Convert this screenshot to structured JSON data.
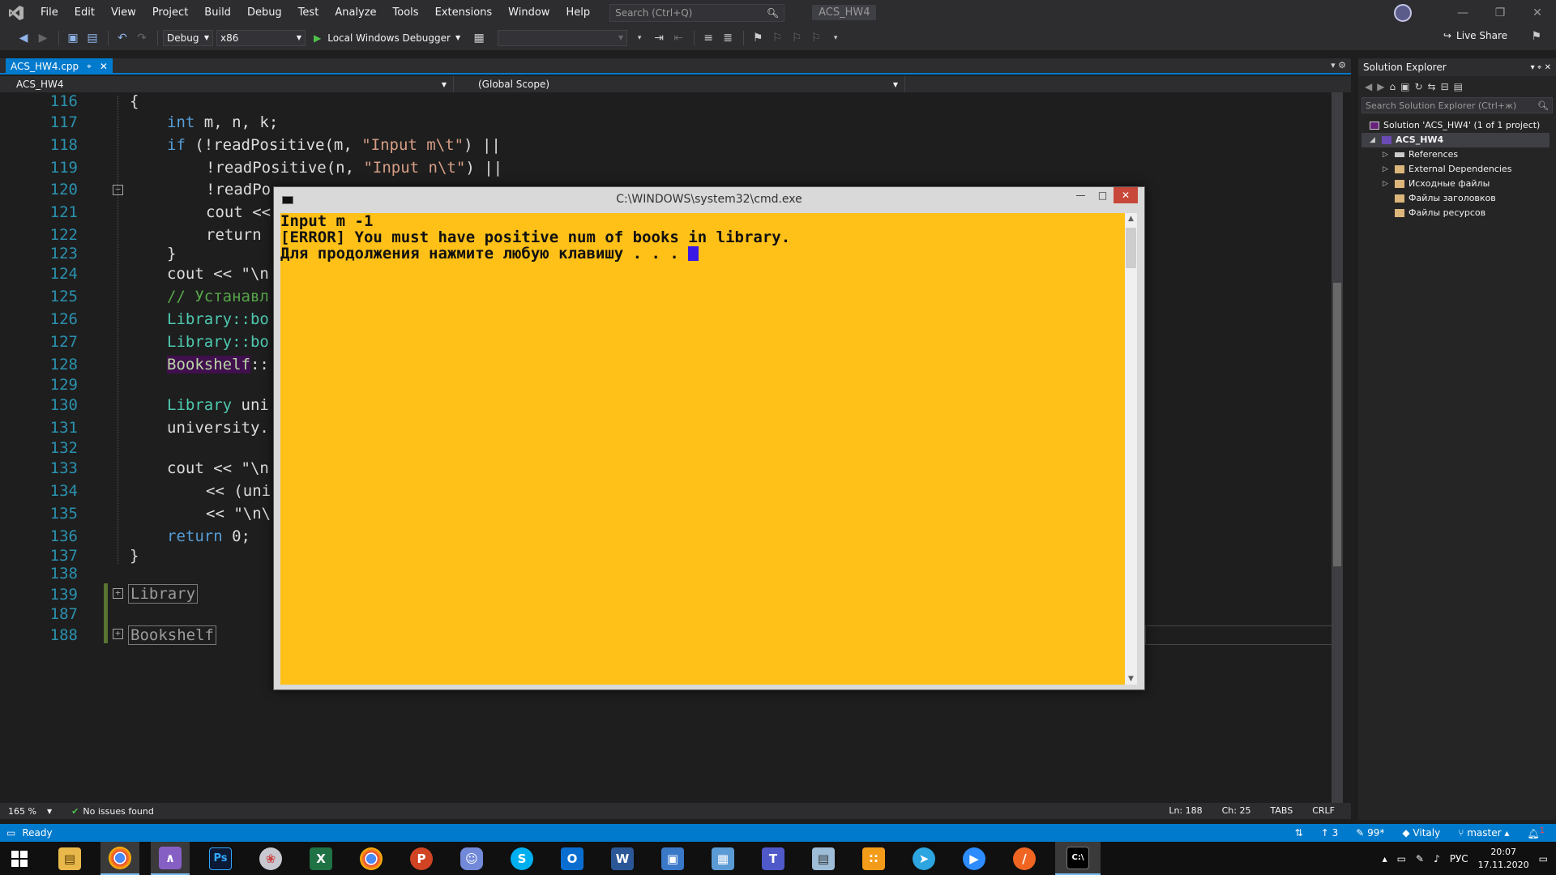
{
  "menu": {
    "items": [
      "File",
      "Edit",
      "View",
      "Project",
      "Build",
      "Debug",
      "Test",
      "Analyze",
      "Tools",
      "Extensions",
      "Window",
      "Help"
    ],
    "search_placeholder": "Search (Ctrl+Q)",
    "app_title": "ACS_HW4"
  },
  "toolbar": {
    "configuration": "Debug",
    "platform": "x86",
    "run_label": "Local Windows Debugger",
    "live_share": "Live Share"
  },
  "tab": {
    "filename": "ACS_HW4.cpp"
  },
  "navbar": {
    "project": "ACS_HW4",
    "scope": "(Global Scope)"
  },
  "editor": {
    "line_numbers": [
      "116",
      "117",
      "118",
      "119",
      "120",
      "121",
      "122",
      "123",
      "124",
      "125",
      "126",
      "127",
      "128",
      "129",
      "130",
      "131",
      "132",
      "133",
      "134",
      "135",
      "136",
      "137",
      "138",
      "139",
      "187",
      "188"
    ],
    "lines": {
      "l116": "{",
      "l117_kw": "int",
      "l117_rest": " m, n, k;",
      "l118_kw": "if",
      "l118_a": " (!readPositive(m, ",
      "l118_str": "\"Input m\\t\"",
      "l118_b": ") ||",
      "l119_a": "!readPositive(n, ",
      "l119_str": "\"Input n\\t\"",
      "l119_b": ") ||",
      "l120": "!readPo",
      "l121": "cout <<",
      "l122": "return",
      "l123": "}",
      "l124": "cout << \"\\n",
      "l125": "// Устанавл",
      "l126": "Library::bo",
      "l127": "Library::bo",
      "l128_hl": "Bookshelf",
      "l128_rest": "::",
      "l130_ty": "Library",
      "l130_rest": " uni",
      "l131": "university.",
      "l133": "cout << \"\\n",
      "l134": "<< (uni",
      "l135": "<< \"\\n\\",
      "l136_kw": "return",
      "l136_rest": " 0;",
      "l137": "}",
      "l139": "Library",
      "l188": "Bookshelf"
    }
  },
  "editor_status": {
    "zoom": "165 %",
    "issues": "No issues found",
    "line": "Ln: 188",
    "col": "Ch: 25",
    "indent": "TABS",
    "eol": "CRLF"
  },
  "solution_explorer": {
    "title": "Solution Explorer",
    "search_placeholder": "Search Solution Explorer (Ctrl+ж)",
    "solution": "Solution 'ACS_HW4' (1 of 1 project)",
    "project": "ACS_HW4",
    "items": [
      "References",
      "External Dependencies",
      "Исходные файлы",
      "Файлы заголовков",
      "Файлы ресурсов"
    ]
  },
  "statusbar": {
    "ready": "Ready",
    "pending": "3",
    "edits": "99*",
    "user": "Vitaly",
    "branch": "master",
    "notifications": "1"
  },
  "cmd": {
    "title": "C:\\WINDOWS\\system32\\cmd.exe",
    "line1": "Input m -1",
    "line2": "[ERROR] You must have positive num of books in library.",
    "line3": "Для продолжения нажмите любую клавишу . . . "
  },
  "taskbar": {
    "language": "РУС",
    "time": "20:07",
    "date": "17.11.2020",
    "apps": [
      "start-icon",
      "file-explorer-icon",
      "chrome-icon",
      "visual-studio-icon",
      "photoshop-icon",
      "paint-icon",
      "excel-icon",
      "chrome-alt-icon",
      "powerpoint-icon",
      "discord-icon",
      "skype-icon",
      "outlook-icon",
      "word-icon",
      "computer-icon",
      "remote-desktop-icon",
      "teams-icon",
      "calculator-icon",
      "network-icon",
      "telegram-icon",
      "zoom-icon",
      "terminal-app-icon",
      "cmd-icon"
    ]
  },
  "colors": {
    "accent": "#007acc",
    "console_bg": "#ffc018",
    "cursor": "#3a18e6"
  }
}
